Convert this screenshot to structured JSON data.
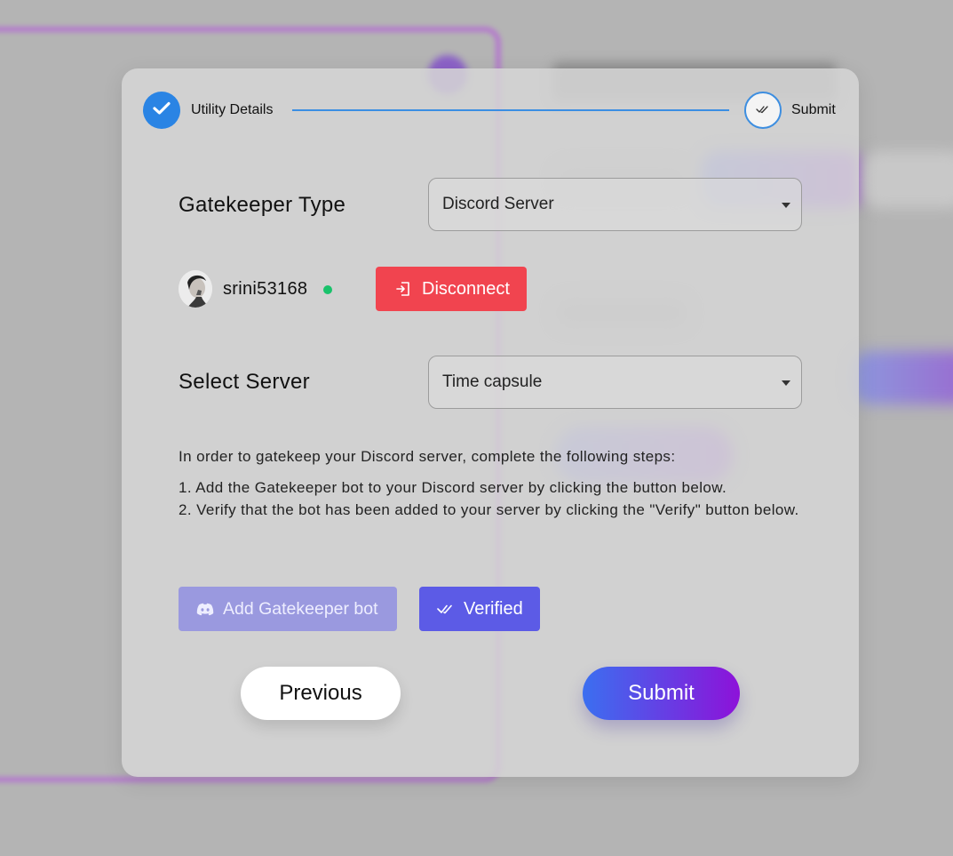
{
  "stepper": {
    "steps": [
      {
        "label": "Utility Details",
        "status": "completed",
        "icon": "check-icon"
      },
      {
        "label": "Submit",
        "status": "current",
        "icon": "double-check-icon"
      }
    ]
  },
  "form": {
    "gatekeeper_type": {
      "label": "Gatekeeper Type",
      "value": "Discord Server"
    },
    "user": {
      "username": "srini53168",
      "status_color": "#19c26b",
      "avatar": "avatar-image"
    },
    "disconnect_button": {
      "label": "Disconnect",
      "color": "#f1444f",
      "icon": "logout-icon"
    },
    "select_server": {
      "label": "Select Server",
      "value": "Time capsule"
    }
  },
  "instructions": {
    "intro": "In order to gatekeep your Discord server, complete the following steps:",
    "steps": [
      "1. Add the Gatekeeper bot to your Discord server by clicking the button below.",
      "2. Verify that the bot has been added to your server by clicking the \"Verify\" button below."
    ]
  },
  "actions": {
    "add_bot": {
      "label": "Add Gatekeeper bot",
      "icon": "discord-icon"
    },
    "verified": {
      "label": "Verified",
      "icon": "double-check-icon",
      "color": "#5c5be6"
    }
  },
  "footer": {
    "previous_label": "Previous",
    "submit_label": "Submit"
  },
  "colors": {
    "accent": "#2a84e4",
    "submit_gradient_start": "#3b6ff0",
    "submit_gradient_end": "#8d12d9"
  }
}
